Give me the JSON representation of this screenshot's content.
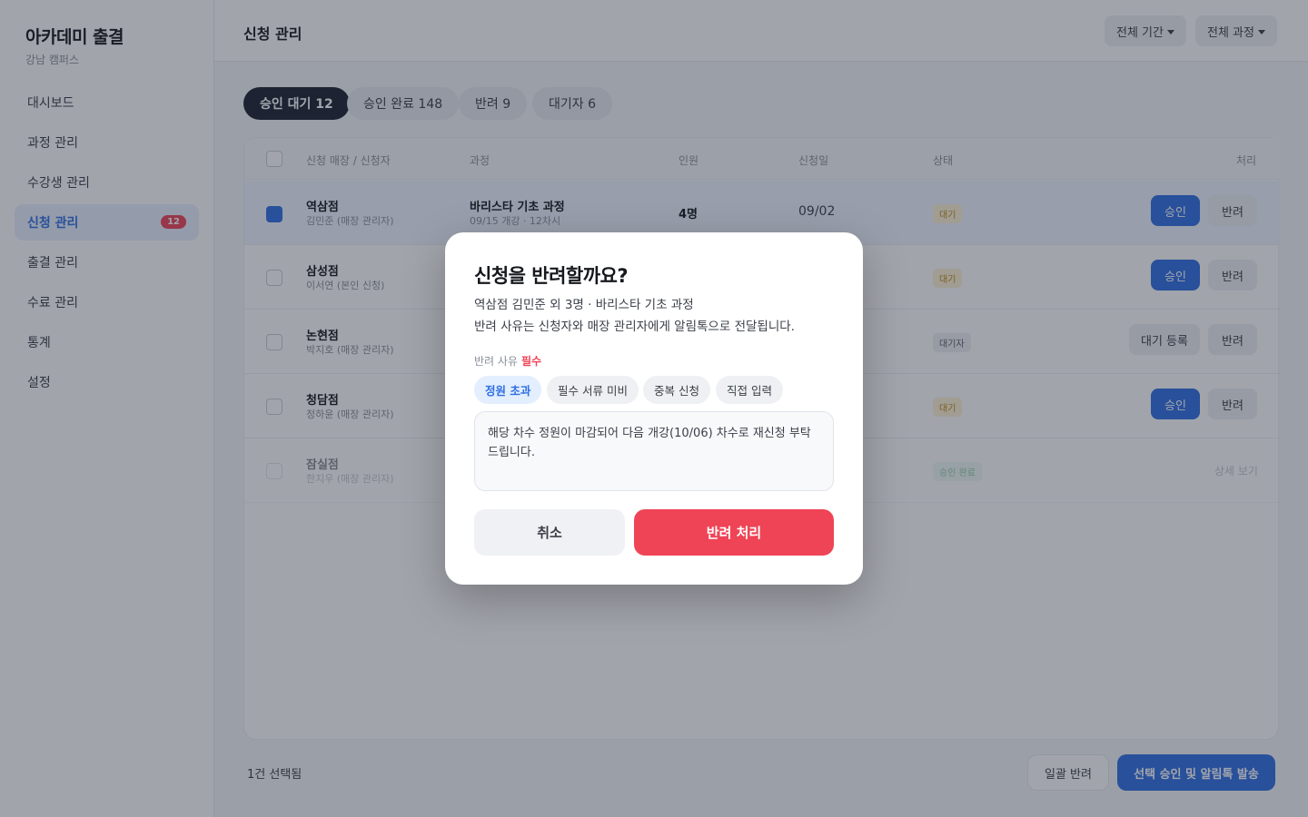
{
  "brand": {
    "title": "아카데미 출결",
    "subtitle": "강남 캠퍼스"
  },
  "sidebar": {
    "items": [
      {
        "label": "대시보드"
      },
      {
        "label": "과정 관리"
      },
      {
        "label": "수강생 관리"
      },
      {
        "label": "신청 관리",
        "badge": "12",
        "active": true
      },
      {
        "label": "출결 관리"
      },
      {
        "label": "수료 관리"
      },
      {
        "label": "통계"
      },
      {
        "label": "설정"
      }
    ]
  },
  "header": {
    "title": "신청 관리",
    "filter_period": "전체 기간",
    "filter_course": "전체 과정"
  },
  "tabs": [
    {
      "label": "승인 대기 12",
      "active": true
    },
    {
      "label": "승인 완료 148"
    },
    {
      "label": "반려 9"
    },
    {
      "label": "대기자 6"
    }
  ],
  "table": {
    "columns": {
      "store": "신청 매장 / 신청자",
      "course": "과정",
      "people": "인원",
      "date": "신청일",
      "status": "상태",
      "action": "처리"
    },
    "rows": [
      {
        "store": "역삼점",
        "applicant": "김민준 (매장 관리자)",
        "course": "바리스타 기초 과정",
        "course_sub": "09/15 개강 · 12차시",
        "people": "4명",
        "date": "09/02",
        "status": "대기",
        "checked": true,
        "approve": "승인",
        "reject": "반려"
      },
      {
        "store": "삼성점",
        "applicant": "이서연 (본인 신청)",
        "status": "대기",
        "approve": "승인",
        "reject": "반려"
      },
      {
        "store": "논현점",
        "applicant": "박지호 (매장 관리자)",
        "status": "대기자",
        "waitreg": "대기 등록",
        "reject": "반려"
      },
      {
        "store": "청담점",
        "applicant": "정하윤 (매장 관리자)",
        "status": "대기",
        "approve": "승인",
        "reject": "반려"
      },
      {
        "store": "잠실점",
        "applicant": "한지우 (매장 관리자)",
        "status": "승인 완료",
        "detail": "상세 보기"
      }
    ]
  },
  "footer": {
    "selected": "1건 선택됨",
    "bulk_reject": "일괄 반려",
    "bulk_approve": "선택 승인 및 알림톡 발송"
  },
  "modal": {
    "title": "신청을 반려할까요?",
    "desc1": "역삼점 김민준 외 3명 · 바리스타 기초 과정",
    "desc2": "반려 사유는 신청자와 매장 관리자에게 알림톡으로 전달됩니다.",
    "reason_label": "반려 사유",
    "required": "필수",
    "chips": [
      "정원 초과",
      "필수 서류 미비",
      "중복 신청",
      "직접 입력"
    ],
    "reason_text": "해당 차수 정원이 마감되어 다음 개강(10/06) 차수로 재신청 부탁드립니다.",
    "cancel": "취소",
    "confirm": "반려 처리"
  },
  "colors": {
    "accent": "#2f6fe4",
    "danger": "#ef4456",
    "dark": "#1c2230"
  }
}
